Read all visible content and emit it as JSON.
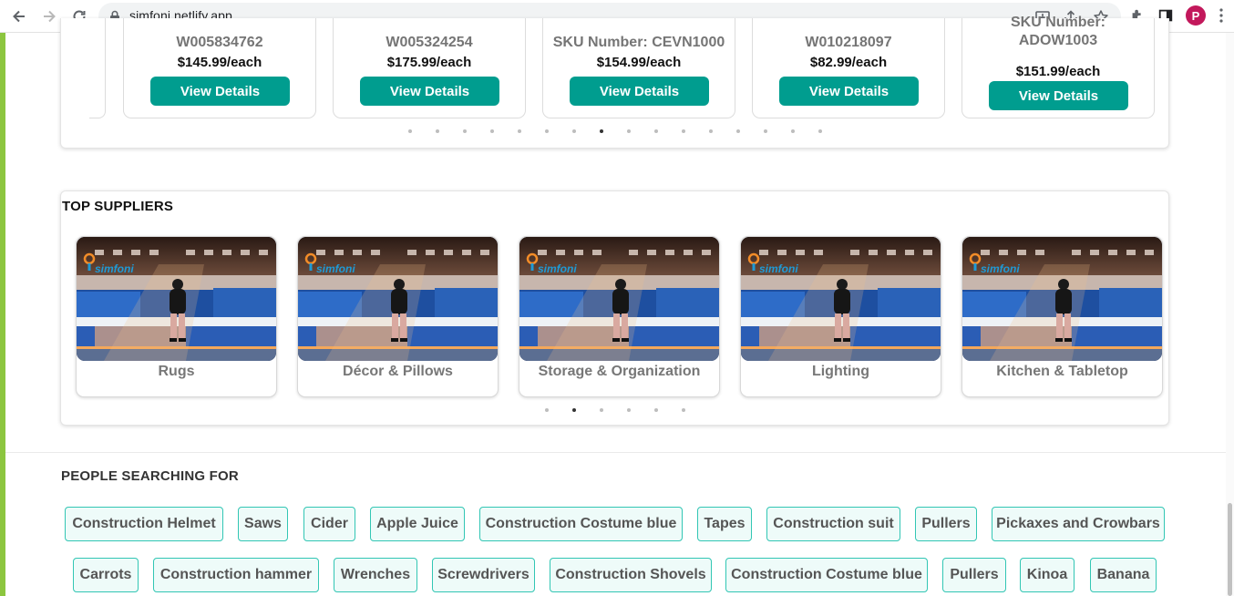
{
  "browser": {
    "url": "simfoni.netlify.app",
    "profile_initial": "P",
    "icons": [
      "back-icon",
      "forward-icon",
      "reload-icon",
      "lock-icon",
      "install-icon",
      "share-icon",
      "bookmark-star-icon",
      "extensions-icon",
      "side-panel-icon",
      "kebab-menu-icon"
    ]
  },
  "products": {
    "items": [
      {
        "sku_lines": [
          "W005834762"
        ],
        "price": "$145.99/each",
        "button": "View Details"
      },
      {
        "sku_lines": [
          "W005324254"
        ],
        "price": "$175.99/each",
        "button": "View Details"
      },
      {
        "sku_lines": [
          "SKU Number: CEVN1000"
        ],
        "price": "$154.99/each",
        "button": "View Details"
      },
      {
        "sku_lines": [
          "W010218097"
        ],
        "price": "$82.99/each",
        "button": "View Details"
      },
      {
        "sku_lines": [
          "SKU Number:",
          "ADOW1003"
        ],
        "price": "$151.99/each",
        "button": "View Details"
      }
    ],
    "dot_count": 16,
    "active_dot": 7
  },
  "suppliers": {
    "title": "TOP SUPPLIERS",
    "logo_text": "simfoni",
    "items": [
      "Rugs",
      "Décor & Pillows",
      "Storage & Organization",
      "Lighting",
      "Kitchen & Tabletop"
    ],
    "dot_count": 6,
    "active_dot": 1
  },
  "searching": {
    "title": "PEOPLE SEARCHING FOR",
    "row1": [
      "Construction Helmet",
      "Saws",
      "Cider",
      "Apple Juice",
      "Construction Costume blue",
      "Tapes",
      "Construction suit",
      "Pullers",
      "Pickaxes and Crowbars"
    ],
    "row2": [
      "Carrots",
      "Construction hammer",
      "Wrenches",
      "Screwdrivers",
      "Construction Shovels",
      "Construction Costume blue",
      "Pullers",
      "Kinoa",
      "Banana"
    ]
  },
  "colors": {
    "accent": "#009d8f",
    "tag_border": "#32c6b4",
    "left_bar": "#8cc63f",
    "avatar": "#c2185b"
  }
}
